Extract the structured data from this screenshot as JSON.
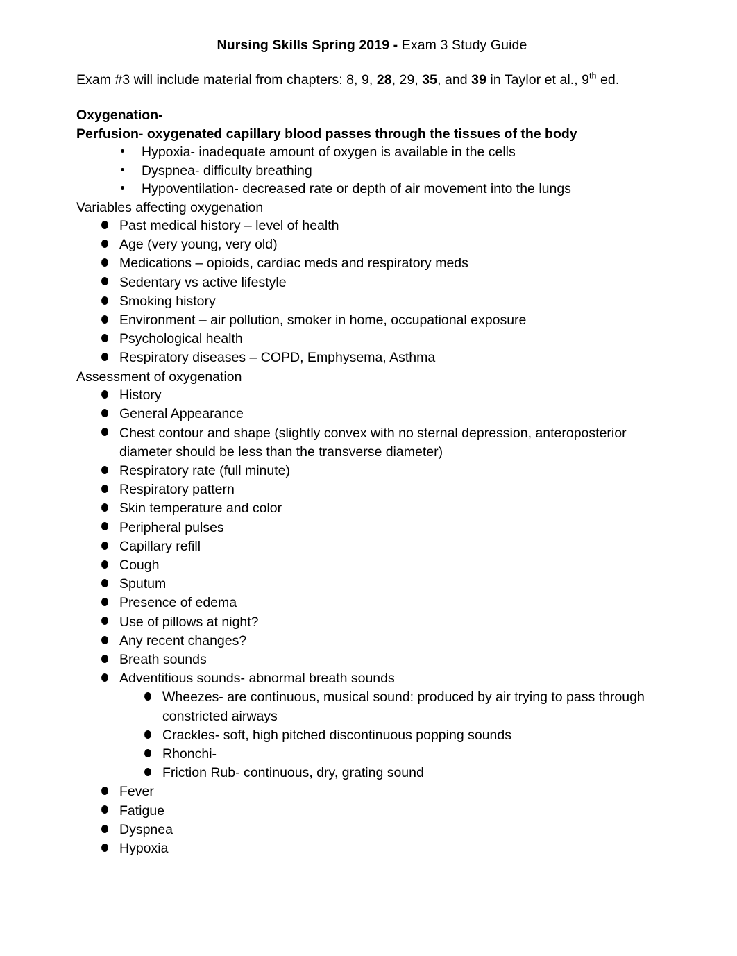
{
  "document": {
    "title_bold": "Nursing Skills Spring 2019 - ",
    "title_regular": "Exam 3 Study Guide",
    "intro": {
      "part1": "Exam #3 will include material from chapters:  8, 9, ",
      "ch1_bold": "28",
      "part2": ", 29, ",
      "ch2_bold": "35",
      "part3": ", and ",
      "ch3_bold": "39",
      "part4": " in Taylor et al., 9",
      "superscript": "th",
      "part5": " ed."
    },
    "sections": [
      {
        "heading_oxygenation": "Oxygenation-",
        "heading_perfusion": "Perfusion- oxygenated capillary blood passes through the tissues of the body",
        "definitions": [
          "Hypoxia- inadequate amount of oxygen is available in the cells",
          "Dyspnea- difficulty breathing",
          "Hypoventilation- decreased rate or depth of air movement into the lungs"
        ]
      },
      {
        "heading_variables": "Variables affecting oxygenation",
        "items": [
          "Past medical history – level of health",
          "Age (very young, very old)",
          "Medications – opioids, cardiac meds and respiratory meds",
          "Sedentary vs active lifestyle",
          "Smoking history",
          "Environment – air pollution, smoker in home, occupational exposure",
          "Psychological health",
          "Respiratory diseases – COPD, Emphysema, Asthma"
        ]
      },
      {
        "heading_assessment": "Assessment of oxygenation",
        "items": [
          "History",
          "General Appearance",
          "Chest contour and shape (slightly convex with no sternal depression, anteroposterior diameter should be less than the transverse diameter)",
          "Respiratory rate (full minute)",
          "Respiratory pattern",
          "Skin temperature and color",
          "Peripheral pulses",
          "Capillary refill",
          "Cough",
          "Sputum",
          "Presence of edema",
          "Use of pillows at night?",
          "Any recent changes?",
          "Breath sounds",
          "Adventitious sounds- abnormal breath sounds"
        ],
        "adventitious_subitems": [
          "Wheezes- are continuous, musical sound: produced by air trying to pass through constricted airways",
          "Crackles- soft, high pitched discontinuous popping sounds",
          "Rhonchi-",
          "Friction Rub- continuous, dry, grating sound"
        ],
        "final_items": [
          "Fever",
          "Fatigue",
          "Dyspnea",
          "Hypoxia"
        ]
      }
    ]
  }
}
